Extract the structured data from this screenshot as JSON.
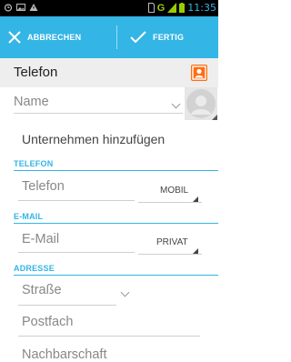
{
  "status_bar": {
    "time": "11:35",
    "network": "G",
    "icons": [
      "alarm-icon",
      "image-icon",
      "warning-icon",
      "sim-icon",
      "signal-icon",
      "battery-icon"
    ]
  },
  "action_bar": {
    "cancel_label": "ABBRECHEN",
    "done_label": "FERTIG",
    "color": "#33b5e5"
  },
  "account": {
    "label": "Telefon",
    "icon_color": "#ff6d10"
  },
  "form": {
    "name_placeholder": "Name",
    "add_organization": "Unternehmen hinzufügen",
    "phone_section": "TELEFON",
    "phone_placeholder": "Telefon",
    "phone_type": "MOBIL",
    "email_section": "E-MAIL",
    "email_placeholder": "E-Mail",
    "email_type": "PRIVAT",
    "address_section": "ADRESSE",
    "street_placeholder": "Straße",
    "pobox_placeholder": "Postfach",
    "neighborhood_placeholder": "Nachbarschaft"
  }
}
